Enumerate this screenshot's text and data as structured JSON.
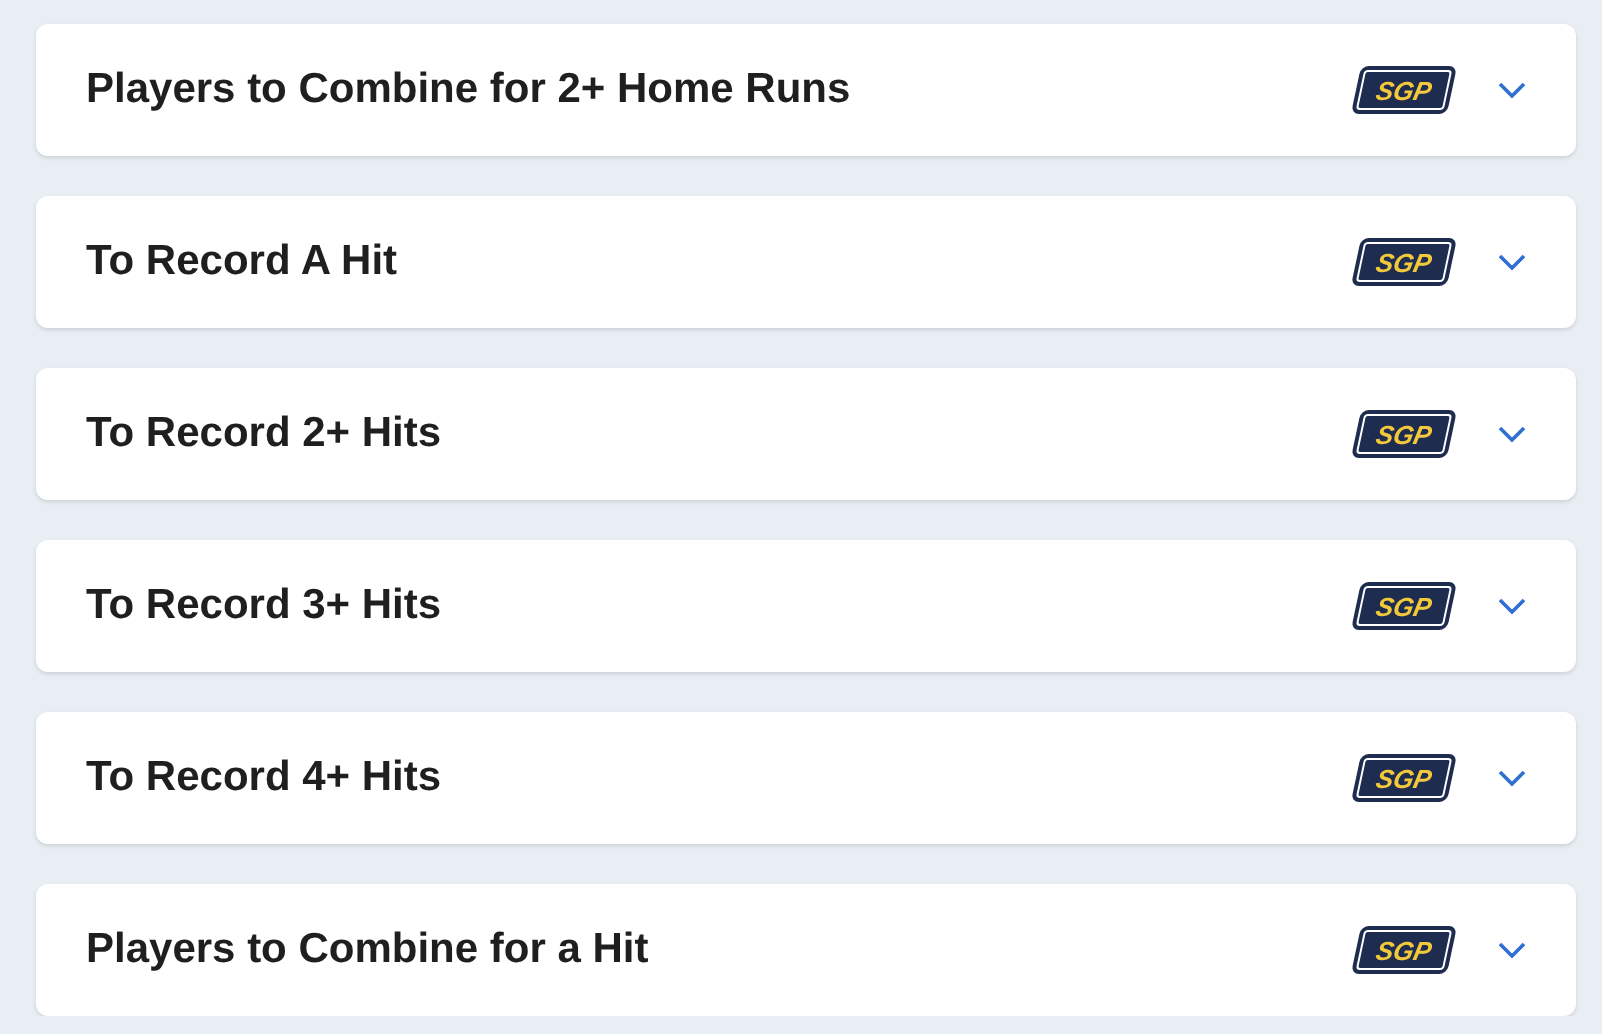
{
  "markets": [
    {
      "title": "Players to Combine for 2+ Home Runs",
      "badge": "SGP",
      "expanded": false
    },
    {
      "title": "To Record A Hit",
      "badge": "SGP",
      "expanded": false
    },
    {
      "title": "To Record 2+ Hits",
      "badge": "SGP",
      "expanded": false
    },
    {
      "title": "To Record 3+ Hits",
      "badge": "SGP",
      "expanded": false
    },
    {
      "title": "To Record 4+ Hits",
      "badge": "SGP",
      "expanded": false
    },
    {
      "title": "Players to Combine for a Hit",
      "badge": "SGP",
      "expanded": false
    }
  ]
}
